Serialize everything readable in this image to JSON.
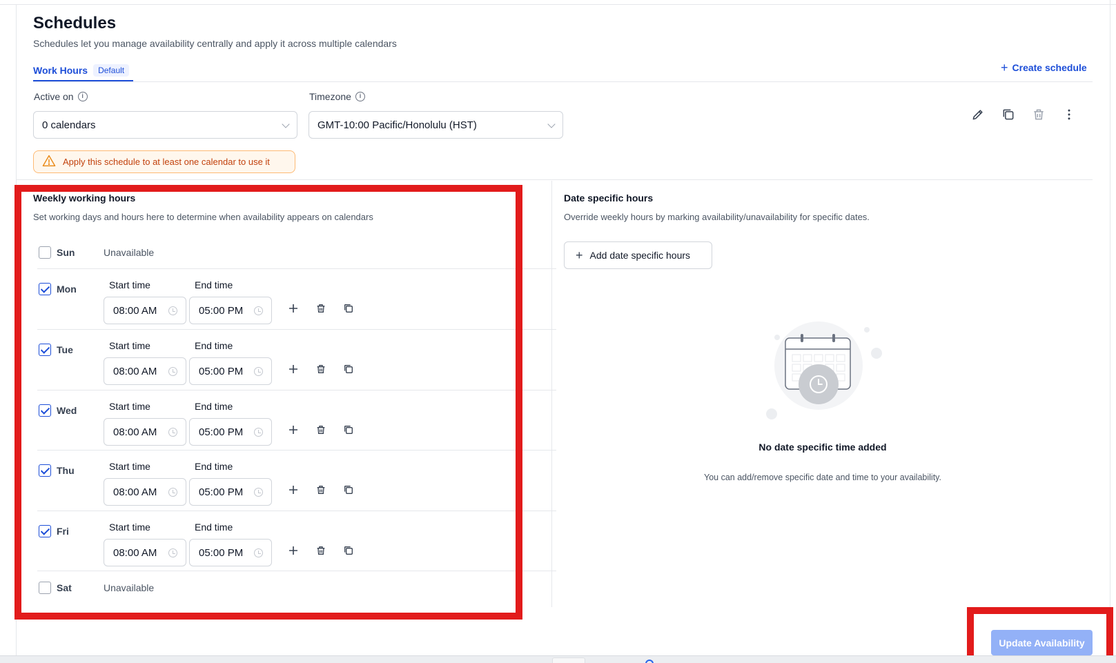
{
  "header": {
    "title": "Schedules",
    "subtitle": "Schedules let you manage availability centrally and apply it across multiple calendars",
    "create_label": "Create schedule"
  },
  "tabs": [
    {
      "label": "Work Hours",
      "badge": "Default",
      "active": true
    }
  ],
  "form": {
    "active_on_label": "Active on",
    "active_on_value": "0 calendars",
    "timezone_label": "Timezone",
    "timezone_value": "GMT-10:00 Pacific/Honolulu (HST)"
  },
  "toolbar_icons": [
    "pencil-icon",
    "copy-icon",
    "trash-icon",
    "more-vertical-icon"
  ],
  "warning": {
    "text": "Apply this schedule to at least one calendar to use it",
    "icon": "warning-triangle-icon"
  },
  "weekly": {
    "title": "Weekly working hours",
    "subtitle": "Set working days and hours here to determine when availability appears on calendars",
    "start_label": "Start time",
    "end_label": "End time",
    "unavailable_label": "Unavailable",
    "days": [
      {
        "name": "Sun",
        "checked": false,
        "start": "",
        "end": ""
      },
      {
        "name": "Mon",
        "checked": true,
        "start": "08:00 AM",
        "end": "05:00 PM"
      },
      {
        "name": "Tue",
        "checked": true,
        "start": "08:00 AM",
        "end": "05:00 PM"
      },
      {
        "name": "Wed",
        "checked": true,
        "start": "08:00 AM",
        "end": "05:00 PM"
      },
      {
        "name": "Thu",
        "checked": true,
        "start": "08:00 AM",
        "end": "05:00 PM"
      },
      {
        "name": "Fri",
        "checked": true,
        "start": "08:00 AM",
        "end": "05:00 PM"
      },
      {
        "name": "Sat",
        "checked": false,
        "start": "",
        "end": ""
      }
    ]
  },
  "date_specific": {
    "title": "Date specific hours",
    "subtitle": "Override weekly hours by marking availability/unavailability for specific dates.",
    "add_label": "Add date specific hours",
    "empty_title": "No date specific time added",
    "empty_subtitle": "You can add/remove specific date and time to your availability."
  },
  "footer": {
    "update_label": "Update Availability"
  },
  "colors": {
    "accent": "#1d4ed8",
    "warning_bg": "#fff7ed",
    "warning_text": "#c2410c",
    "highlight": "#e21b1b",
    "update_button": "#93b1f7"
  }
}
